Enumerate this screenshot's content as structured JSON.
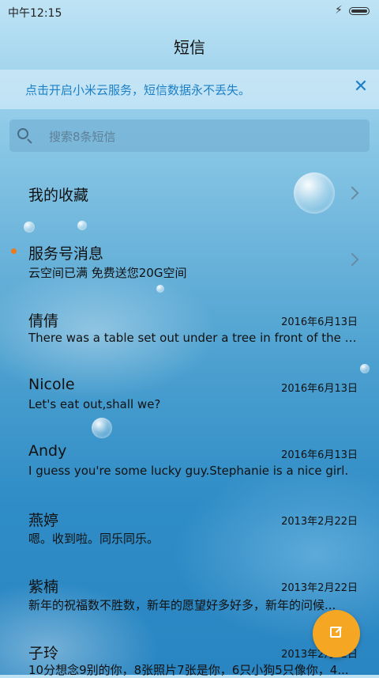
{
  "status_bar": {
    "time": "中午12:15"
  },
  "header": {
    "title": "短信"
  },
  "banner": {
    "text": "点击开启小米云服务，短信数据永不丢失。",
    "close": "✕"
  },
  "search": {
    "placeholder": "搜索8条短信"
  },
  "conversations": [
    {
      "name": "我的收藏",
      "preview": "",
      "date": "",
      "chevron": true,
      "unread": false
    },
    {
      "name": "服务号消息",
      "preview": "云空间已满 免费送您20G空间",
      "date": "",
      "chevron": true,
      "unread": true
    },
    {
      "name": "倩倩",
      "preview": "There was a table set out under a tree in front of the ho...",
      "date": "2016年6月13日"
    },
    {
      "name": "Nicole",
      "preview": "Let's eat out,shall we?",
      "date": "2016年6月13日"
    },
    {
      "name": "Andy",
      "preview": "I guess you're some lucky guy.Stephanie is a nice girl.",
      "date": "2016年6月13日"
    },
    {
      "name": "燕婷",
      "preview": "嗯。收到啦。同乐同乐。",
      "date": "2013年2月22日"
    },
    {
      "name": "紫楠",
      "preview": "新年的祝福数不胜数，新年的愿望好多好多，新年的问候...",
      "date": "2013年2月22日"
    },
    {
      "name": "子玲",
      "preview": "10分想念9别的你，8张照片7张是你，6只小狗5只像你，4...",
      "date": "2013年2月22日"
    }
  ],
  "fab": {
    "icon": "compose-icon"
  },
  "colors": {
    "accent": "#1d7fc6",
    "fab": "#f5a623",
    "unread_dot": "#f07a1a"
  }
}
